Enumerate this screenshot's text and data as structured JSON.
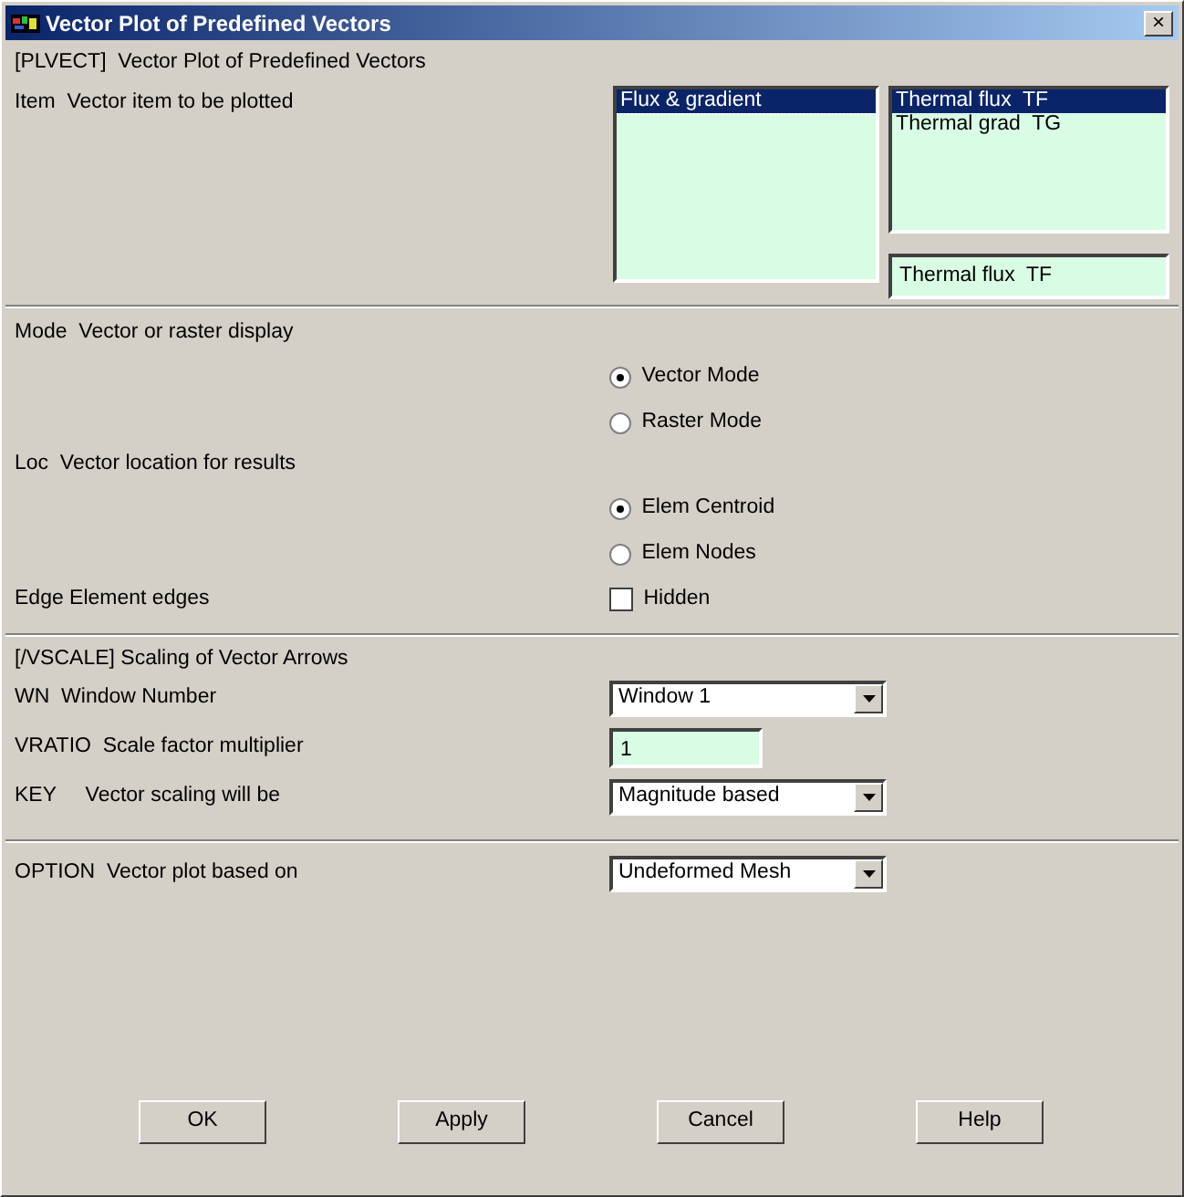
{
  "window": {
    "title": "Vector Plot of Predefined Vectors",
    "close": "×"
  },
  "item_section": {
    "header": "[PLVECT]  Vector Plot of Predefined Vectors",
    "label": "Item  Vector item to be plotted",
    "categories": [
      {
        "label": "Flux & gradient",
        "selected": true
      }
    ],
    "components": [
      {
        "label": "Thermal flux  TF",
        "selected": true
      },
      {
        "label": "Thermal grad  TG",
        "selected": false
      }
    ],
    "selection_value": "Thermal flux  TF"
  },
  "display_section": {
    "groups": [
      {
        "kind": "radio",
        "label": "Mode  Vector or raster display",
        "options": [
          {
            "label": "Vector Mode",
            "selected": true
          },
          {
            "label": "Raster Mode",
            "selected": false
          }
        ]
      },
      {
        "kind": "radio",
        "label": "Loc  Vector location for results",
        "options": [
          {
            "label": "Elem Centroid",
            "selected": true
          },
          {
            "label": "Elem Nodes",
            "selected": false
          }
        ]
      },
      {
        "kind": "checkbox",
        "label": "Edge Element edges",
        "options": [
          {
            "label": "Hidden",
            "checked": false
          }
        ]
      }
    ]
  },
  "scale_section": {
    "header": "[/VSCALE] Scaling of Vector Arrows",
    "fields": [
      {
        "kind": "combo",
        "label": "WN  Window Number",
        "value": "Window 1"
      },
      {
        "kind": "text",
        "label": "VRATIO  Scale factor multiplier",
        "value": "1"
      },
      {
        "kind": "combo",
        "label": "KEY     Vector scaling will be",
        "value": "Magnitude based"
      }
    ]
  },
  "option_section": {
    "fields": [
      {
        "kind": "combo",
        "label": "OPTION  Vector plot based on",
        "value": "Undeformed Mesh"
      }
    ]
  },
  "buttons": [
    "OK",
    "Apply",
    "Cancel",
    "Help"
  ]
}
